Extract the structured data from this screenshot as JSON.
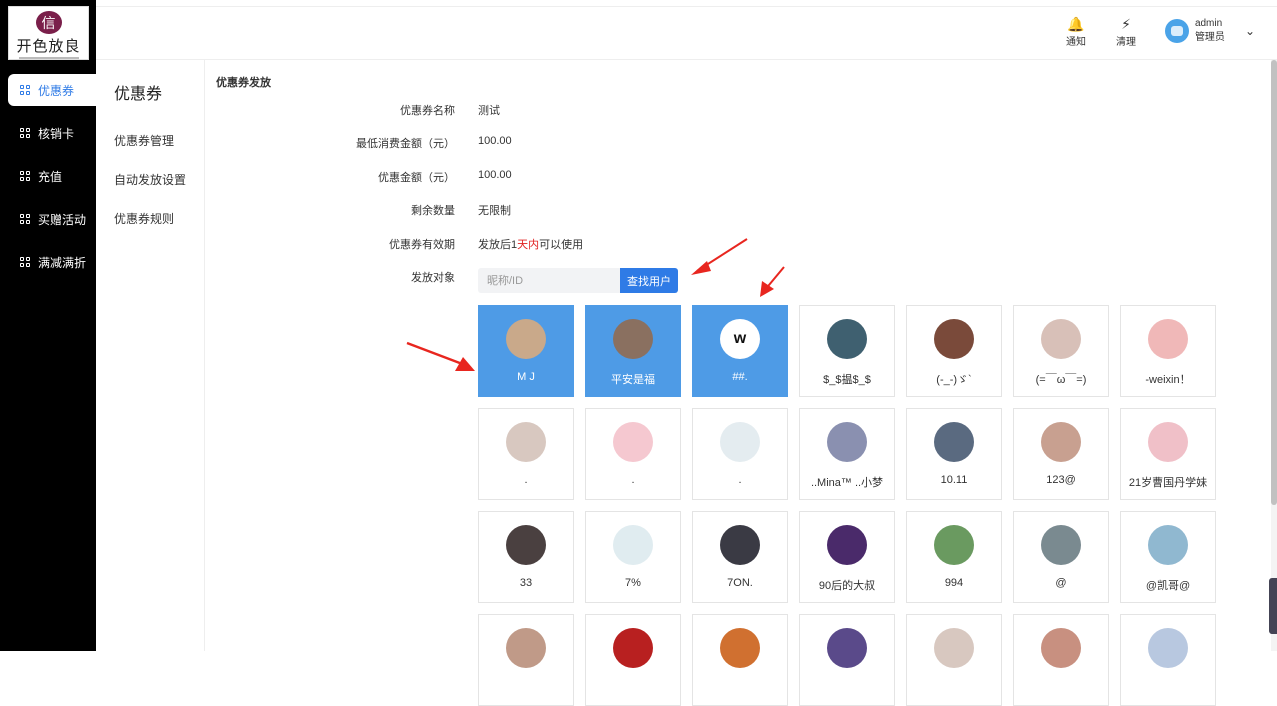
{
  "logo": {
    "mark": "信",
    "brand": "开色放良"
  },
  "nav": [
    {
      "label": "优惠券",
      "active": true
    },
    {
      "label": "核销卡",
      "active": false
    },
    {
      "label": "充值",
      "active": false
    },
    {
      "label": "买赠活动",
      "active": false
    },
    {
      "label": "满减满折",
      "active": false
    }
  ],
  "submenu": {
    "title": "优惠券",
    "items": [
      "优惠券管理",
      "自动发放设置",
      "优惠券规则"
    ]
  },
  "topbar": {
    "notify_label": "通知",
    "notify_icon": "bell-icon",
    "clear_label": "清理",
    "clear_icon": "lightning-icon",
    "user_name": "admin",
    "user_role": "管理员"
  },
  "form": {
    "section_title": "优惠券发放",
    "rows": [
      {
        "label": "优惠券名称",
        "value": "测试"
      },
      {
        "label": "最低消费金额（元）",
        "value": "100.00"
      },
      {
        "label": "优惠金额（元）",
        "value": "100.00"
      },
      {
        "label": "剩余数量",
        "value": "无限制"
      }
    ],
    "validity_label": "优惠券有效期",
    "validity_prefix": "发放后1",
    "validity_highlight": "天内",
    "validity_suffix": "可以使用",
    "target_label": "发放对象",
    "search_placeholder": "昵称/ID",
    "search_button": "查找用户"
  },
  "colors": {
    "accent": "#2f7be6",
    "selected_card": "#4e9be6",
    "sidebar": "#000000",
    "highlight_red": "#e02020",
    "arrow_red": "#e8261f"
  },
  "users": [
    {
      "name": "M J",
      "selected": true,
      "avatar_color": "#c9a98a"
    },
    {
      "name": "平安是福",
      "selected": true,
      "avatar_color": "#8a7060"
    },
    {
      "name": "##.",
      "selected": true,
      "avatar_color": "#ffffff"
    },
    {
      "name": "$_$揾$_$",
      "selected": false,
      "avatar_color": "#3f6070"
    },
    {
      "name": "(-_-)ゞ`",
      "selected": false,
      "avatar_color": "#7a4a3a"
    },
    {
      "name": "(=￣ω￣=)",
      "selected": false,
      "avatar_color": "#d8c0b8"
    },
    {
      "name": "-weixin！",
      "selected": false,
      "avatar_color": "#f0b8b8"
    },
    {
      "name": ".",
      "selected": false,
      "avatar_color": "#d8c8c0"
    },
    {
      "name": ".",
      "selected": false,
      "avatar_color": "#f5c8d0"
    },
    {
      "name": ".",
      "selected": false,
      "avatar_color": "#e4ecf0"
    },
    {
      "name": "..Mina™ ..小梦",
      "selected": false,
      "avatar_color": "#8a90b0"
    },
    {
      "name": "10.11",
      "selected": false,
      "avatar_color": "#5a6a80"
    },
    {
      "name": "123@",
      "selected": false,
      "avatar_color": "#c8a090"
    },
    {
      "name": "21岁曹国丹学妹",
      "selected": false,
      "avatar_color": "#f0c0c8"
    },
    {
      "name": "33",
      "selected": false,
      "avatar_color": "#4a4040"
    },
    {
      "name": "7%",
      "selected": false,
      "avatar_color": "#e0ecf0"
    },
    {
      "name": "7ON.",
      "selected": false,
      "avatar_color": "#3a3a44"
    },
    {
      "name": "90后的大叔",
      "selected": false,
      "avatar_color": "#4a2a6a"
    },
    {
      "name": "994",
      "selected": false,
      "avatar_color": "#6a9a60"
    },
    {
      "name": "@",
      "selected": false,
      "avatar_color": "#7a8a90"
    },
    {
      "name": "@凯哥@",
      "selected": false,
      "avatar_color": "#90b8d0"
    },
    {
      "name": "",
      "selected": false,
      "avatar_color": "#c09a88"
    },
    {
      "name": "",
      "selected": false,
      "avatar_color": "#b82020"
    },
    {
      "name": "",
      "selected": false,
      "avatar_color": "#d07030"
    },
    {
      "name": "",
      "selected": false,
      "avatar_color": "#5a4a8a"
    },
    {
      "name": "",
      "selected": false,
      "avatar_color": "#d8c8c0"
    },
    {
      "name": "",
      "selected": false,
      "avatar_color": "#c89080"
    },
    {
      "name": "",
      "selected": false,
      "avatar_color": "#b8c8e0"
    }
  ]
}
